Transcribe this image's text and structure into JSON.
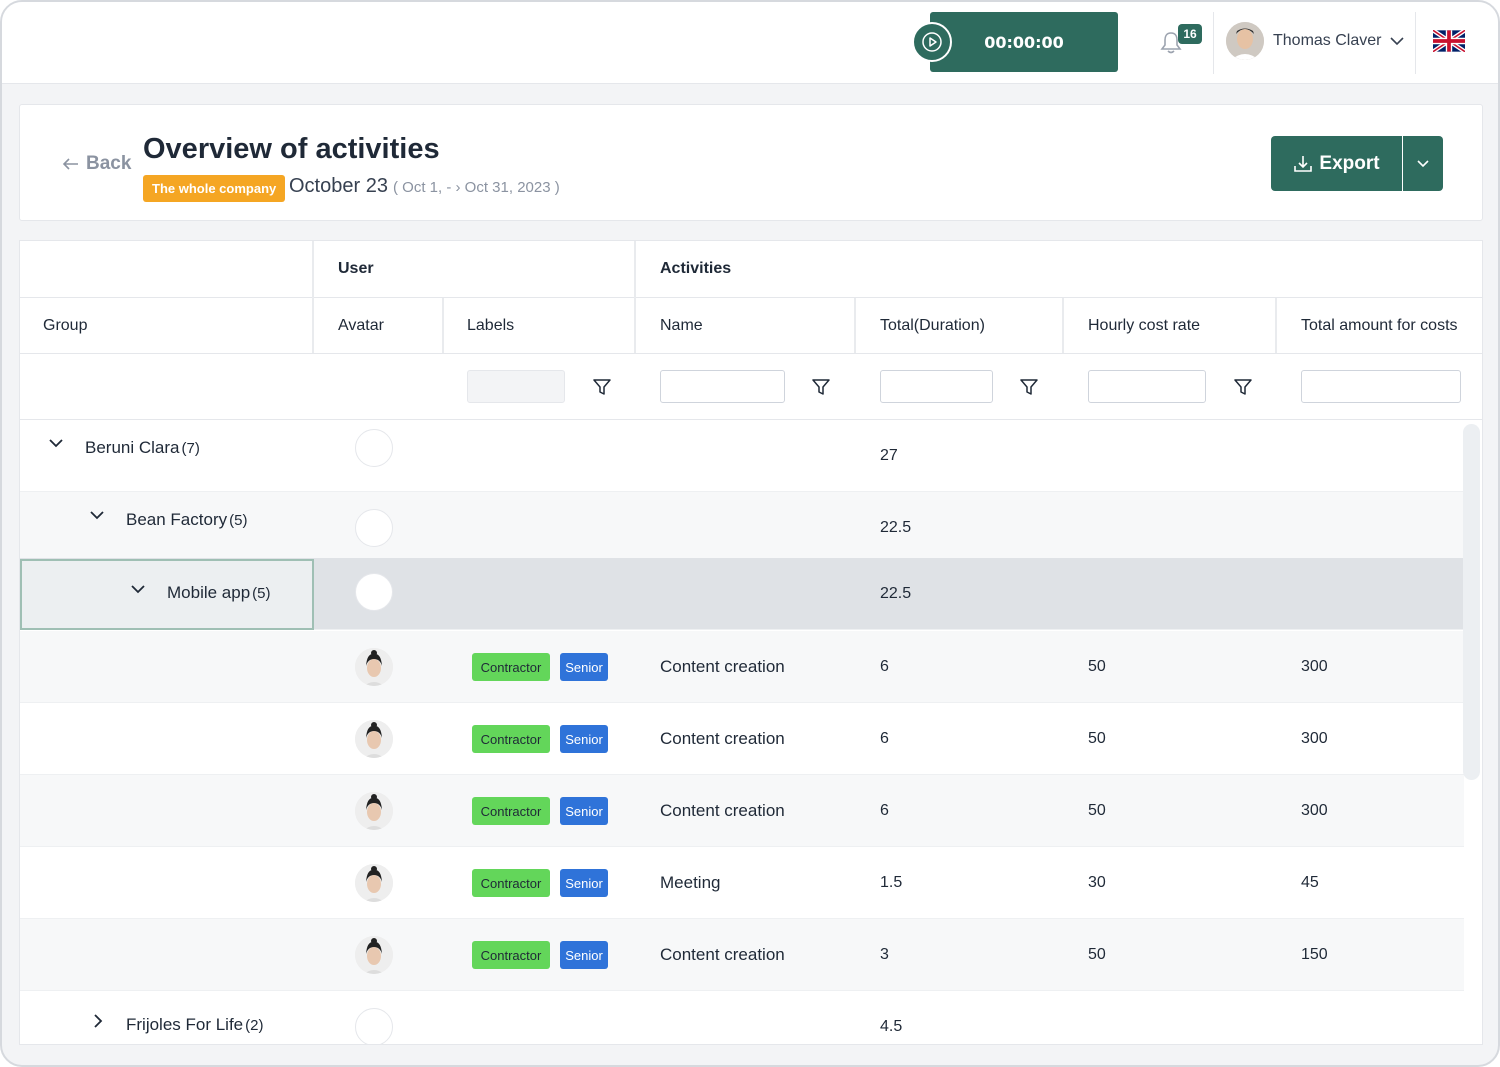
{
  "topbar": {
    "timer": "00:00:00",
    "notifications_count": "16",
    "user_name": "Thomas Claver",
    "language_flag": "uk-flag-icon"
  },
  "header": {
    "back_label": "Back",
    "title": "Overview of activities",
    "scope_badge": "The whole company",
    "period": "October 23",
    "range": "( Oct 1, - › Oct 31, 2023 )",
    "export_label": "Export"
  },
  "table": {
    "group_headers": {
      "user": "User",
      "activities": "Activities"
    },
    "columns": {
      "group": "Group",
      "avatar": "Avatar",
      "labels": "Labels",
      "name": "Name",
      "total_duration": "Total(Duration)",
      "hourly_rate": "Hourly cost rate",
      "total_amount": "Total amount for costs"
    },
    "groups": [
      {
        "label": "Beruni Clara",
        "count": "(7)",
        "total": "27"
      },
      {
        "label": "Bean Factory",
        "count": "(5)",
        "total": "22.5"
      },
      {
        "label": "Mobile app",
        "count": "(5)",
        "total": "22.5"
      },
      {
        "label": "Frijoles For Life",
        "count": "(2)",
        "total": "4.5"
      }
    ],
    "rows": [
      {
        "tag1": "Contractor",
        "tag2": "Senior",
        "name": "Content creation",
        "duration": "6",
        "rate": "50",
        "amount": "300"
      },
      {
        "tag1": "Contractor",
        "tag2": "Senior",
        "name": "Content creation",
        "duration": "6",
        "rate": "50",
        "amount": "300"
      },
      {
        "tag1": "Contractor",
        "tag2": "Senior",
        "name": "Content creation",
        "duration": "6",
        "rate": "50",
        "amount": "300"
      },
      {
        "tag1": "Contractor",
        "tag2": "Senior",
        "name": "Meeting",
        "duration": "1.5",
        "rate": "30",
        "amount": "45"
      },
      {
        "tag1": "Contractor",
        "tag2": "Senior",
        "name": "Content creation",
        "duration": "3",
        "rate": "50",
        "amount": "150"
      }
    ]
  },
  "colors": {
    "primary": "#2e6b5e",
    "badge_orange": "#f5a623",
    "tag_green": "#63d65a",
    "tag_blue": "#2f73d9"
  }
}
